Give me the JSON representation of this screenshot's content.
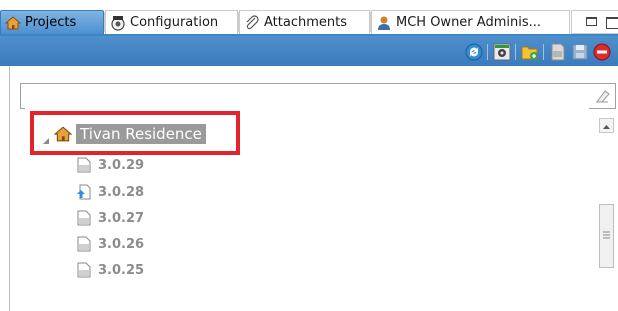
{
  "tabs": [
    {
      "label": "Projects",
      "icon": "house-icon",
      "active": true
    },
    {
      "label": "Configuration",
      "icon": "config-icon",
      "active": false
    },
    {
      "label": "Attachments",
      "icon": "paperclip-icon",
      "active": false
    },
    {
      "label": "MCH Owner Adminis...",
      "icon": "user-icon",
      "active": false
    }
  ],
  "toolbar": {
    "buttons": [
      "refresh-icon",
      "tools-icon",
      "new-folder-icon",
      "version-icon",
      "save-icon",
      "delete-icon"
    ]
  },
  "filter": {
    "value": "",
    "placeholder": ""
  },
  "tree": {
    "root": {
      "label": "Tivan Residence",
      "icon": "house-icon"
    },
    "versions": [
      {
        "label": "3.0.29",
        "icon": "version-doc-icon"
      },
      {
        "label": "3.0.28",
        "icon": "version-upload-icon"
      },
      {
        "label": "3.0.27",
        "icon": "version-doc-icon"
      },
      {
        "label": "3.0.26",
        "icon": "version-doc-icon"
      },
      {
        "label": "3.0.25",
        "icon": "version-doc-icon"
      }
    ]
  },
  "colors": {
    "accent": "#3d86c6",
    "highlight": "#e3242b",
    "selected_bg": "#9a9a9a"
  }
}
